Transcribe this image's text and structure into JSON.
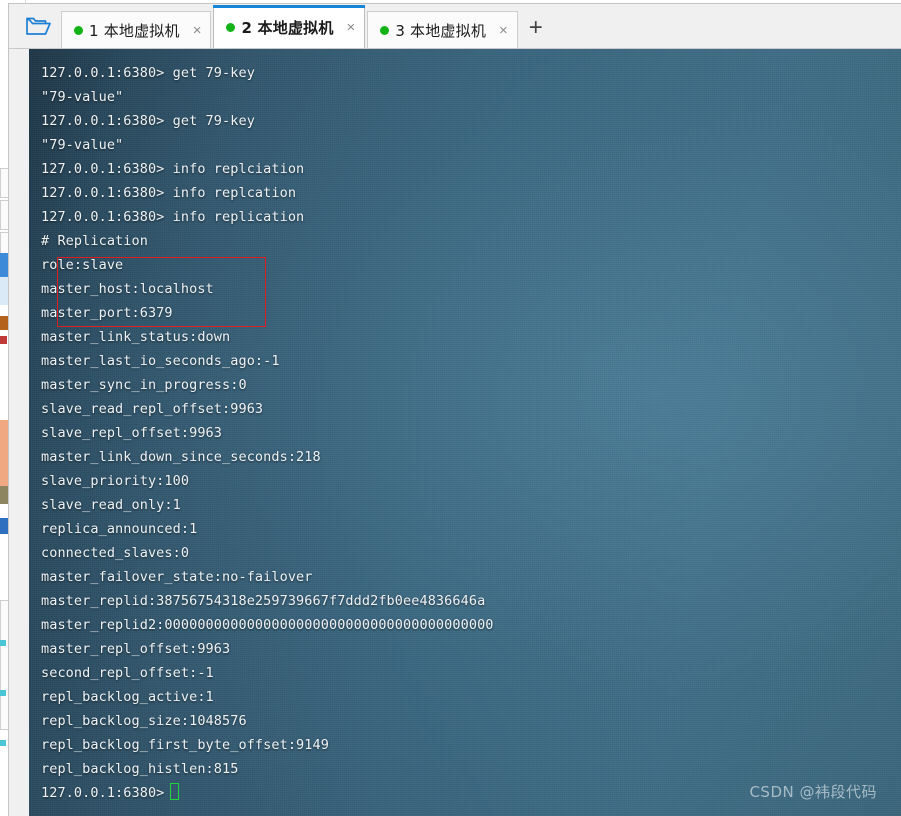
{
  "window": {
    "folder_icon": "open-folder-icon",
    "new_tab_label": "+"
  },
  "tabs": [
    {
      "index": "1",
      "label": "1 本地虚拟机",
      "status": "connected",
      "status_color": "#12b317",
      "close_label": "×",
      "active": false
    },
    {
      "index": "2",
      "label": "2 本地虚拟机",
      "status": "connected",
      "status_color": "#12b317",
      "close_label": "×",
      "active": true
    },
    {
      "index": "3",
      "label": "3 本地虚拟机",
      "status": "connected",
      "status_color": "#12b317",
      "close_label": "×",
      "active": false
    }
  ],
  "terminal": {
    "prompt": "127.0.0.1:6380>",
    "cursor": "block-cursor",
    "accent_box_color": "#e02020",
    "background_color": "#37617a",
    "text_color": "#eef2f4",
    "lines": [
      "127.0.0.1:6380> get 79-key",
      "\"79-value\"",
      "127.0.0.1:6380> get 79-key",
      "\"79-value\"",
      "127.0.0.1:6380> info replciation",
      "127.0.0.1:6380> info replcation",
      "127.0.0.1:6380> info replication",
      "# Replication",
      "role:slave",
      "master_host:localhost",
      "master_port:6379",
      "master_link_status:down",
      "master_last_io_seconds_ago:-1",
      "master_sync_in_progress:0",
      "slave_read_repl_offset:9963",
      "slave_repl_offset:9963",
      "master_link_down_since_seconds:218",
      "slave_priority:100",
      "slave_read_only:1",
      "replica_announced:1",
      "connected_slaves:0",
      "master_failover_state:no-failover",
      "master_replid:38756754318e259739667f7ddd2fb0ee4836646a",
      "master_replid2:0000000000000000000000000000000000000000",
      "master_repl_offset:9963",
      "second_repl_offset:-1",
      "repl_backlog_active:1",
      "repl_backlog_size:1048576",
      "repl_backlog_first_byte_offset:9149",
      "repl_backlog_histlen:815"
    ],
    "last_prompt": "127.0.0.1:6380>",
    "highlighted_lines": [
      "role:slave",
      "master_host:localhost",
      "master_port:6379"
    ]
  },
  "watermark": {
    "text": "CSDN @袆段代码"
  }
}
